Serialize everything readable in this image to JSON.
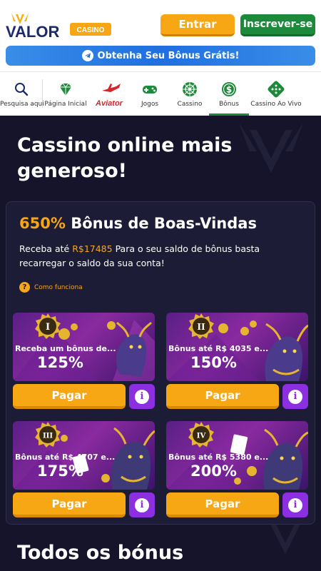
{
  "header": {
    "logo_word": "VALOR",
    "logo_sub": "CASINO",
    "login_label": "Entrar",
    "signup_label": "Inscrever-se",
    "banner_text": "Obtenha Seu Bônus Grátis!"
  },
  "nav": {
    "items": [
      {
        "label": "Pesquisa aqui",
        "icon": "search-icon"
      },
      {
        "label": "Página Inicial",
        "icon": "diamond-icon"
      },
      {
        "label": "Aviator",
        "icon": "aviator-plane-icon"
      },
      {
        "label": "Jogos",
        "icon": "gamepad-icon"
      },
      {
        "label": "Cassino",
        "icon": "roulette-icon"
      },
      {
        "label": "Bônus",
        "icon": "dollar-coin-icon"
      },
      {
        "label": "Cassino Ao Vivo",
        "icon": "dice-icon"
      }
    ],
    "active": "Bônus",
    "aviator_logo": "Aviator"
  },
  "main": {
    "title": "Cassino online mais generoso!",
    "welcome": {
      "percent": "650%",
      "title_rest": "Bônus de Boas-Vindas",
      "desc_prefix": "Receba até",
      "amount": "R$17485",
      "desc_suffix": "Para o seu saldo de bônus basta recarregar o saldo da sua conta!",
      "how_label": "Como funciona",
      "how_icon": "?"
    },
    "tiles": [
      {
        "badge": "I",
        "text": "Receba um bônus de...",
        "percent": "125%",
        "pay": "Pagar"
      },
      {
        "badge": "II",
        "text": "Bônus até R$ 4035 e...",
        "percent": "150%",
        "pay": "Pagar"
      },
      {
        "badge": "III",
        "text": "Bônus até R$ 4707 e...",
        "percent": "175%",
        "pay": "Pagar"
      },
      {
        "badge": "IV",
        "text": "Bônus até R$ 5380 e...",
        "percent": "200%",
        "pay": "Pagar"
      }
    ],
    "all_title": "Todos os bónus"
  },
  "colors": {
    "accent": "#f7a614",
    "green": "#1c8a3a",
    "blue": "#1f6fe0",
    "purple": "#8b2fe0",
    "bg": "#15142b"
  }
}
